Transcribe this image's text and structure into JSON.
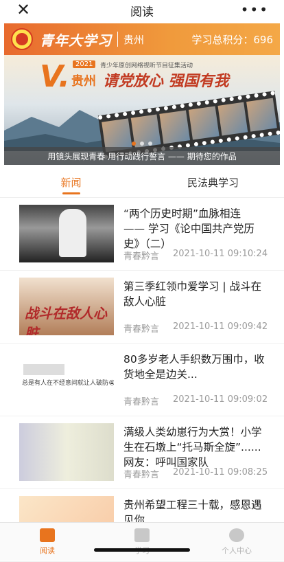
{
  "topbar": {
    "close_icon": "✕",
    "title": "阅读",
    "more_icon": "•••"
  },
  "header": {
    "brand": "青年大学习",
    "region": "贵州",
    "score_label": "学习总积分：",
    "score_value": "696"
  },
  "banner": {
    "year": "2021",
    "subtitle": "青少年原创网络视听节目征集活动",
    "v_letter": "V.",
    "guizhou": "贵州",
    "slogan": "请党放心 强国有我",
    "caption": "用镜头展现青春 用行动践行誓言 —— 期待您的作品"
  },
  "tabs": [
    {
      "label": "新闻",
      "active": true
    },
    {
      "label": "民法典学习",
      "active": false
    }
  ],
  "articles": [
    {
      "title": "“两个历史时期”血脉相连 —— 学习《论中国共产党历史》（二）",
      "source": "青春黔言",
      "time": "2021-10-11 09:10:24"
    },
    {
      "title": "第三季红领巾爱学习 | 战斗在敌人心脏",
      "source": "青春黔言",
      "time": "2021-10-11 09:09:42",
      "thumb_text": "战斗在敌人心脏"
    },
    {
      "title": "80多岁老人手织数万围巾，收货地全是边关...",
      "source": "青春黔言",
      "time": "2021-10-11 09:09:02",
      "thumb_text": "总是有人在不经意间就让人破防😭"
    },
    {
      "title": "满级人类幼崽行为大赏！小学生在石墩上“托马斯全旋”......网友：呼叫国家队",
      "source": "青春黔言",
      "time": "2021-10-11 09:08:25"
    },
    {
      "title": "贵州希望工程三十载，感恩遇见你",
      "source": "",
      "time": ""
    }
  ],
  "bottom_nav": [
    {
      "label": "阅读",
      "icon": "book-open-icon",
      "active": true
    },
    {
      "label": "学习",
      "icon": "book-icon",
      "active": false
    },
    {
      "label": "个人中心",
      "icon": "user-icon",
      "active": false
    }
  ],
  "colors": {
    "accent": "#e8741e",
    "header_start": "#e86a2e",
    "header_end": "#f4a847"
  }
}
